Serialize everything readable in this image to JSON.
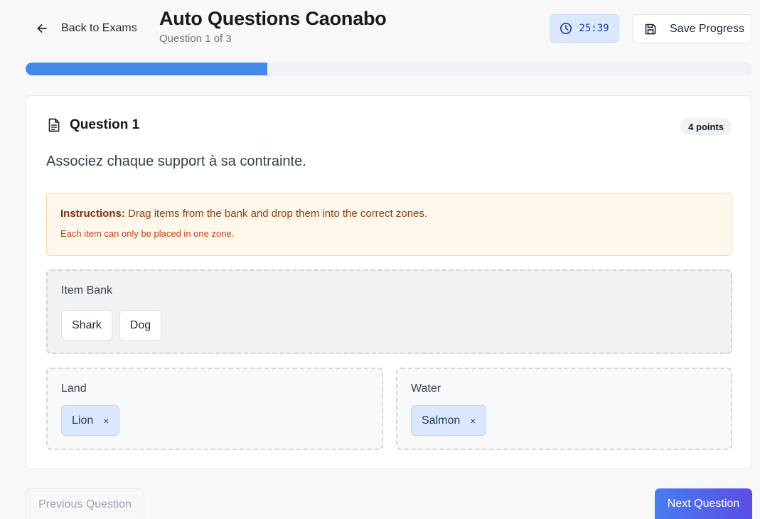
{
  "header": {
    "back_label": "Back to Exams",
    "title": "Auto Questions Caonabo",
    "subtitle": "Question 1 of 3",
    "timer": "25:39",
    "save_label": "Save Progress"
  },
  "progress": {
    "current": 1,
    "total": 3,
    "fraction": 0.333
  },
  "question": {
    "title": "Question 1",
    "points": "4 points",
    "text": "Associez chaque support à sa contrainte."
  },
  "instructions": {
    "label": "Instructions:",
    "text": " Drag items from the bank and drop them into the correct zones.",
    "note": "Each item can only be placed in one zone."
  },
  "bank": {
    "title": "Item Bank",
    "items": [
      "Shark",
      "Dog"
    ]
  },
  "zones": [
    {
      "title": "Land",
      "items": [
        "Lion"
      ]
    },
    {
      "title": "Water",
      "items": [
        "Salmon"
      ]
    }
  ],
  "remove_symbol": "×",
  "footer": {
    "prev_label": "Previous Question",
    "next_label": "Next Question"
  },
  "colors": {
    "accent": "#4388ec",
    "timer_bg": "#dbe8fc",
    "instruction_bg": "#fff6ec",
    "next_gradient_start": "#4a7cf0",
    "next_gradient_end": "#5b4de6"
  },
  "icons": {
    "back": "arrow-left-icon",
    "timer": "clock-icon",
    "save": "floppy-disk-icon",
    "question": "document-icon"
  }
}
